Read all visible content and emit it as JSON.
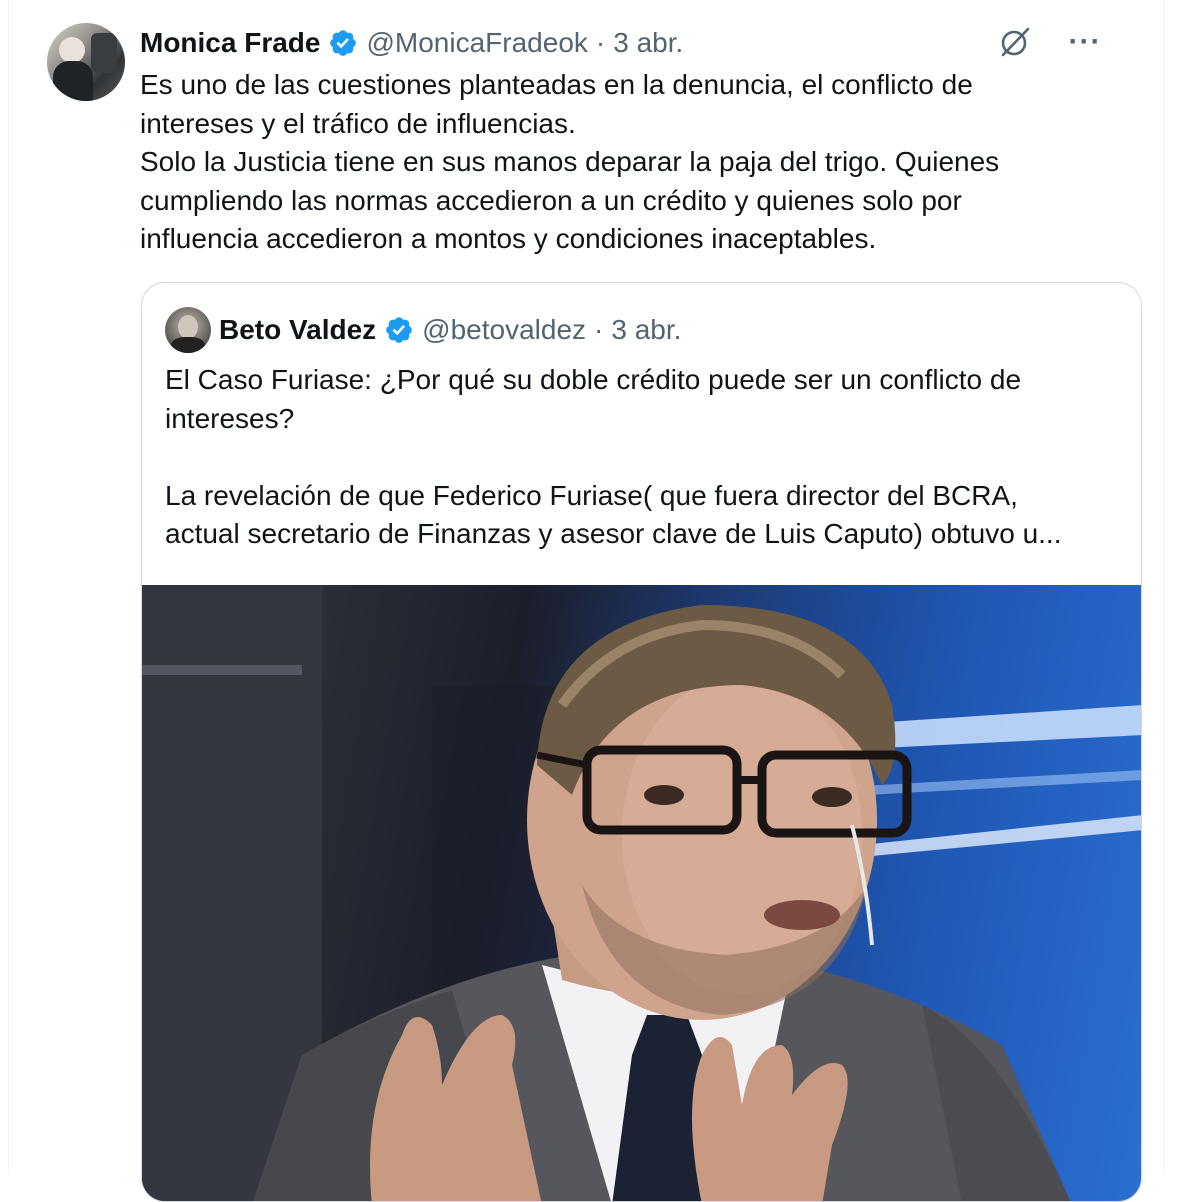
{
  "tweet": {
    "author_name": "Monica Frade",
    "handle": "@MonicaFradeok",
    "separator": "·",
    "date": "3 abr.",
    "more_label": "···",
    "text": "Es uno de las cuestiones planteadas en la denuncia, el conflicto de\nintereses y el tráfico de influencias.\nSolo la Justicia tiene en sus manos deparar la paja del trigo. Quienes\ncumpliendo las normas accedieron a un crédito y quienes solo por\ninfluencia accedieron a montos y condiciones inaceptables."
  },
  "quoted": {
    "author_name": "Beto Valdez",
    "handle": "@betovaldez",
    "separator": "·",
    "date": "3 abr.",
    "text": "El Caso Furiase: ¿Por qué su doble crédito puede ser un conflicto de\nintereses?\n\nLa revelación de que Federico Furiase( que fuera director del BCRA,\nactual secretario de Finanzas y asesor clave de Luis Caputo) obtuvo u..."
  },
  "icons": {
    "verified": "verified-badge-icon",
    "grok": "grok-icon",
    "more": "more-options-icon"
  },
  "colors": {
    "verified_blue": "#1d9bf0",
    "secondary_text": "#536471",
    "border": "#cfd9de"
  }
}
